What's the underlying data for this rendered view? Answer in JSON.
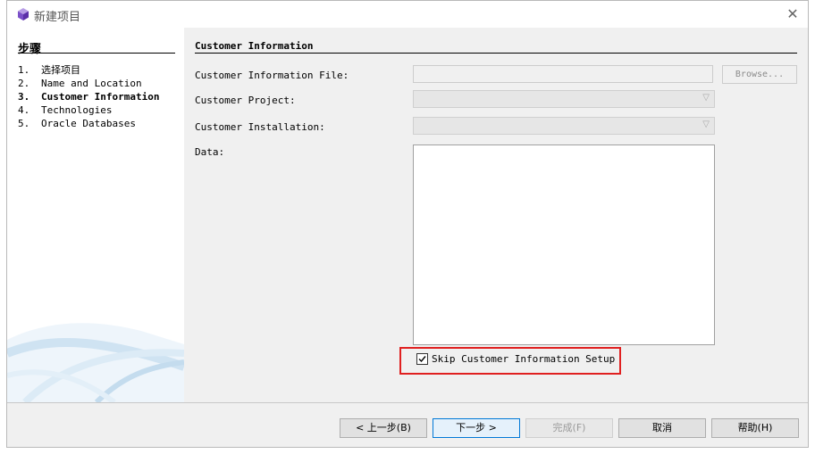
{
  "window": {
    "title": "新建项目",
    "close_glyph": "✕",
    "icon": "cube-icon"
  },
  "steps": {
    "heading": "步骤",
    "items": [
      {
        "num": "1.",
        "label": "选择项目",
        "current": false
      },
      {
        "num": "2.",
        "label": "Name and Location",
        "current": false
      },
      {
        "num": "3.",
        "label": "Customer Information",
        "current": true
      },
      {
        "num": "4.",
        "label": "Technologies",
        "current": false
      },
      {
        "num": "5.",
        "label": "Oracle Databases",
        "current": false
      }
    ]
  },
  "panel": {
    "title": "Customer Information",
    "file_label": "Customer Information File:",
    "file_value": "",
    "browse_label": "Browse...",
    "project_label": "Customer Project:",
    "project_value": "",
    "installation_label": "Customer Installation:",
    "installation_value": "",
    "data_label": "Data:",
    "data_value": "",
    "skip_label": "Skip Customer Information Setup",
    "skip_checked": true
  },
  "buttons": {
    "back": "< 上一步(B)",
    "next": "下一步 >",
    "finish": "完成(F)",
    "cancel": "取消",
    "help": "帮助(H)"
  },
  "colors": {
    "highlight_border": "#e02020",
    "primary_border": "#0078d7"
  }
}
